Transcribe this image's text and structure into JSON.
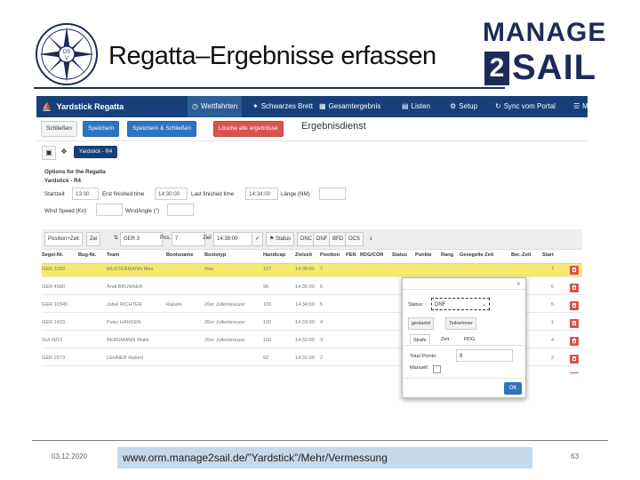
{
  "slide": {
    "title": "Regatta–Ergebnisse erfassen",
    "brand_top": "MANAGE",
    "brand_number": "2",
    "brand_bottom": "SAIL",
    "footer_date": "03.12.2020",
    "footer_url": "www.orm.manage2sail.de/”Yardstick”/Mehr/Vermessung",
    "page_number": "63"
  },
  "app": {
    "brand": "Yardstick Regatta",
    "nav": [
      {
        "label": "Wettfahrten",
        "icon": "clock-icon",
        "active": true
      },
      {
        "label": "Schwarzes Brett",
        "icon": "pushpin-icon",
        "active": false
      },
      {
        "label": "Gesamtergebnis",
        "icon": "chart-icon",
        "active": false
      },
      {
        "label": "Listen",
        "icon": "document-icon",
        "active": false
      },
      {
        "label": "Setup",
        "icon": "gear-icon",
        "active": false
      },
      {
        "label": "Sync vom Portal",
        "icon": "sync-icon",
        "active": false
      },
      {
        "label": "M",
        "icon": "menu-icon",
        "active": false
      }
    ],
    "toolbar": {
      "back_label": "Schließen",
      "save_label": "Speichern",
      "save_close_label": "Speichern & Schließen",
      "delete_label": "Lösche alle ergebnisse",
      "service_title": "Ergebnisdienst"
    },
    "tab_label": "Yardstick - R4",
    "options": {
      "heading": "Options for the Regatta",
      "subheading": "Yardstick - R4",
      "start_label": "Startzeit",
      "start_value": "13:00",
      "first_finished_label": "Erst finished time",
      "first_finished_value": "14:30:00",
      "last_finished_label": "Last finished time",
      "last_finished_value": "14:34:00",
      "limit_label": "Länge (NM)",
      "limit_value": "",
      "wind_speed_label": "Wind Speed (Kn)",
      "wind_speed_value": "",
      "wind_angle_label": "WindAngle (°)",
      "wind_angle_value": ""
    },
    "filterbar": {
      "position_toggle": "Position+Zeit",
      "zoom_toggle": "Zei",
      "segel_value": "GER 3",
      "pos_label": "Pos.",
      "pos_value": "7",
      "ziel_label": "Ziel",
      "ziel_value": "14:38:00",
      "status_label": "Status",
      "dnc": "DNC",
      "dnf": "DNF",
      "bfd": "BFD",
      "ocs": "OCS"
    },
    "table": {
      "columns": [
        "Segel-Nr.",
        "Bug-Nr.",
        "Team",
        "Bootsname",
        "Bootstyp",
        "Handicap",
        "Zielzeit",
        "Position",
        "PEN",
        "RDG/COR",
        "Status",
        "Punkte",
        "Rang",
        "Gesegelte Zeit",
        "Ber.-Zeit",
        "Start"
      ],
      "rows": [
        {
          "segel": "GER 3183",
          "team": "MUSTERMANN Max",
          "boot": "",
          "typ": "Max",
          "handicap": "107",
          "ziel": "14:38:00",
          "pos": "7",
          "status": "",
          "start": "7",
          "hl": true
        },
        {
          "segel": "GER 4580",
          "team": "Andi BRUNNER",
          "boot": "",
          "typ": "",
          "handicap": "96",
          "ziel": "14:35:00",
          "pos": "6",
          "status": "",
          "start": "6",
          "hl": false
        },
        {
          "segel": "GER 10345",
          "team": "Jubel RICHTER",
          "boot": "Rakete",
          "typ": "20er Jollenkreuzer",
          "handicap": "100",
          "ziel": "14:34:00",
          "pos": "5",
          "status": "",
          "start": "5",
          "hl": false
        },
        {
          "segel": "GER 1423",
          "team": "Peter HANSEN",
          "boot": "",
          "typ": "20er Jollenkreuzer",
          "handicap": "100",
          "ziel": "14:33:00",
          "pos": "4",
          "status": "",
          "start": "1",
          "hl": false
        },
        {
          "segel": "SUI 5015",
          "team": "BERGMANN Waldi",
          "boot": "",
          "typ": "20er Jollenkreuzer",
          "handicap": "100",
          "ziel": "14:32:00",
          "pos": "3",
          "status": "",
          "start": "4",
          "hl": false
        },
        {
          "segel": "GER 2573",
          "team": "LEHNER Hubert",
          "boot": "",
          "typ": "",
          "handicap": "92",
          "ziel": "14:31:00",
          "pos": "2",
          "status": "",
          "start": "2",
          "hl": false
        },
        {
          "segel": "AUT 3333",
          "team": "HUBER Oli",
          "boot": "",
          "typ": "",
          "handicap": "92",
          "ziel": "14:30:00",
          "pos": "1",
          "status": "",
          "start": "3",
          "hl": false
        }
      ]
    },
    "modal": {
      "close": "×",
      "status_label": "Status:",
      "status_value": "DNF",
      "btn_started": "gestartet",
      "btn_participant": "Teilnehmer",
      "tabs": [
        "Strafe",
        "Zeit",
        "RDG"
      ],
      "total_points_label": "Total Points:",
      "total_points_value": "8",
      "manual_label": "Manuell:",
      "ok_label": "OK"
    }
  }
}
